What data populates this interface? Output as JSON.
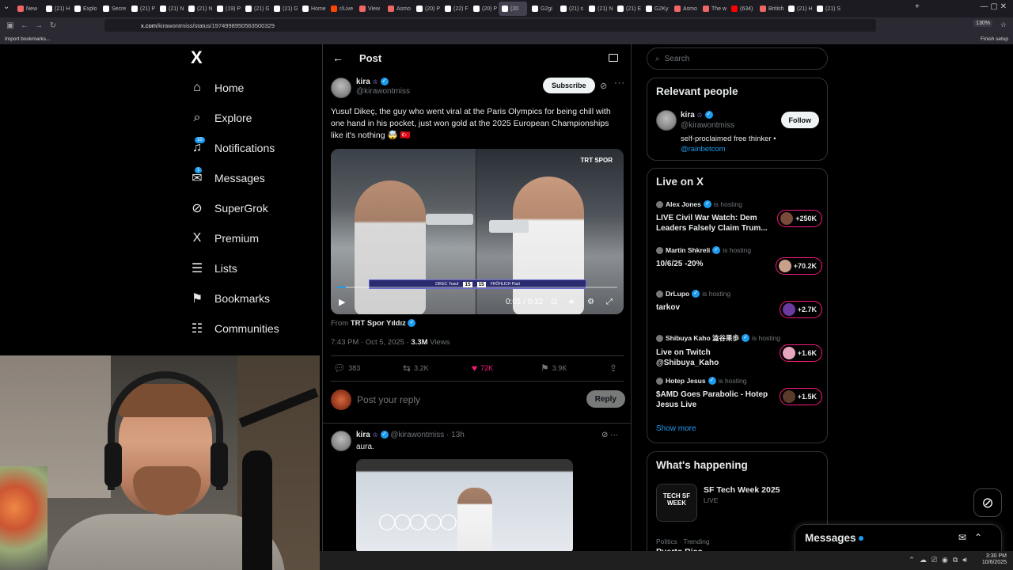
{
  "browser": {
    "tabs": [
      {
        "label": "New",
        "color": "#e66"
      },
      {
        "label": "(21) H",
        "color": "#fff"
      },
      {
        "label": "Explo",
        "color": "#fff"
      },
      {
        "label": "Secre",
        "color": "#fff"
      },
      {
        "label": "(21) P",
        "color": "#fff"
      },
      {
        "label": "(21) N",
        "color": "#fff"
      },
      {
        "label": "(21) N",
        "color": "#fff"
      },
      {
        "label": "(19) P",
        "color": "#fff"
      },
      {
        "label": "(21) G",
        "color": "#fff"
      },
      {
        "label": "(21) G",
        "color": "#fff"
      },
      {
        "label": "Home",
        "color": "#fff"
      },
      {
        "label": "r/Live",
        "color": "#ff4500"
      },
      {
        "label": "View",
        "color": "#e66"
      },
      {
        "label": "Asmo",
        "color": "#e66"
      },
      {
        "label": "(20) P",
        "color": "#fff"
      },
      {
        "label": "(22) F",
        "color": "#fff"
      },
      {
        "label": "(20) P",
        "color": "#fff"
      },
      {
        "label": "(20",
        "color": "#fff"
      },
      {
        "label": "G2gi",
        "color": "#fff"
      },
      {
        "label": "(21) s",
        "color": "#fff"
      },
      {
        "label": "(21) N",
        "color": "#fff"
      },
      {
        "label": "(21) E",
        "color": "#fff"
      },
      {
        "label": "G2Ky",
        "color": "#fff"
      },
      {
        "label": "Asmo",
        "color": "#e66"
      },
      {
        "label": "The w",
        "color": "#e66"
      },
      {
        "label": "(634)",
        "color": "#f00"
      },
      {
        "label": "British",
        "color": "#e66"
      },
      {
        "label": "(21) H",
        "color": "#fff"
      },
      {
        "label": "(21) S",
        "color": "#fff"
      }
    ],
    "active_tab_index": 17,
    "url_domain": "x.com",
    "url_path": "/kirawontmiss/status/1974998950563500329",
    "zoom": "130%",
    "bookmarks_label": "Import bookmarks...",
    "finish_setup": "Finish setup"
  },
  "nav": {
    "logo": "X",
    "items": [
      {
        "label": "Home",
        "icon": "⌂",
        "badge": ""
      },
      {
        "label": "Explore",
        "icon": "⌕",
        "badge": ""
      },
      {
        "label": "Notifications",
        "icon": "♫",
        "badge": "10"
      },
      {
        "label": "Messages",
        "icon": "✉",
        "badge": "1"
      },
      {
        "label": "SuperGrok",
        "icon": "⊘",
        "badge": ""
      },
      {
        "label": "Premium",
        "icon": "X",
        "badge": ""
      },
      {
        "label": "Lists",
        "icon": "☰",
        "badge": ""
      },
      {
        "label": "Bookmarks",
        "icon": "⚑",
        "badge": ""
      },
      {
        "label": "Communities",
        "icon": "☷",
        "badge": ""
      }
    ]
  },
  "post": {
    "header_title": "Post",
    "author_name": "kira",
    "author_handle": "@kirawontmiss",
    "subscribe_label": "Subscribe",
    "text": "Yusuf Dikeç, the guy who went viral at the Paris Olympics for being chill with one hand in his pocket, just won gold at the 2025 European Championships like it's nothing 🤯 🇹🇷",
    "video": {
      "brand": "TRT SPOR",
      "score_left": "15",
      "score_right": "15",
      "name_left": "DIKEC Yusuf",
      "name_right": "FRÖHLICH Paul",
      "time": "0:01 / 0:32",
      "progress": 0.03
    },
    "from_label": "From",
    "from_source": "TRT Spor Yıldız",
    "timestamp": "7:43 PM · Oct 5, 2025 · ",
    "views_count": "3.3M",
    "views_label": " Views",
    "replies": "383",
    "reposts": "3.2K",
    "likes": "72K",
    "bookmarks": "3.9K"
  },
  "reply_box": {
    "placeholder": "Post your reply",
    "button": "Reply"
  },
  "reply": {
    "author_name": "kira",
    "author_handle": "@kirawontmiss · 13h",
    "text": "aura."
  },
  "sidebar": {
    "search_placeholder": "Search",
    "relevant_title": "Relevant people",
    "relevant": {
      "name": "kira",
      "handle": "@kirawontmiss",
      "follow": "Follow",
      "bio": "self-proclaimed free thinker  •",
      "bio_link": "@rainbetcom"
    },
    "live_title": "Live on X",
    "live": [
      {
        "host": "Alex Jones",
        "title": "LIVE Civil War Watch: Dem Leaders Falsely Claim Trum...",
        "count": "+250K",
        "avatar_color": "#7a4a3a"
      },
      {
        "host": "Martin Shkreli",
        "title": "10/6/25 -20%",
        "count": "+70.2K",
        "avatar_color": "#c9a08a"
      },
      {
        "host": "DrLupo",
        "title": "tarkov",
        "count": "+2.7K",
        "avatar_color": "#6a3aa0"
      },
      {
        "host": "Shibuya Kaho 澁谷果歩",
        "title": "Live on Twitch @Shibuya_Kaho",
        "count": "+1.6K",
        "avatar_color": "#e6a6c0"
      },
      {
        "host": "Hotep Jesus",
        "title": "$AMD Goes Parabolic - Hotep Jesus Live",
        "count": "+1.5K",
        "avatar_color": "#5a3a2a"
      }
    ],
    "is_hosting": "is hosting",
    "show_more": "Show more",
    "happening_title": "What's happening",
    "trend_title": "SF Tech Week 2025",
    "trend_live": "LIVE",
    "trend_image_text": "TECH SF WEEK",
    "trend_category": "Politics · Trending",
    "trend_next": "Puerto Rico"
  },
  "messages_drawer": {
    "title": "Messages"
  },
  "taskbar": {
    "time": "3:30 PM",
    "date": "10/6/2025"
  }
}
